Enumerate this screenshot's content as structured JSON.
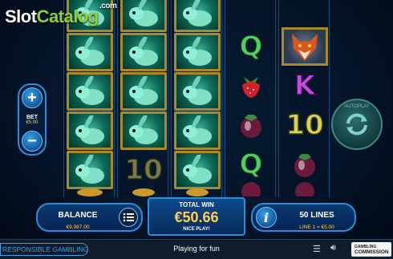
{
  "watermark": {
    "text_a": "Slot",
    "text_b": "Catalog",
    "suffix": ".com"
  },
  "colors": {
    "accent": "#2a8fd8",
    "gold": "#ffd24a",
    "panel": "#0b3b73",
    "link": "#3aa0e8"
  },
  "reels": [
    {
      "symbols": [
        "rabbit",
        "rabbit",
        "rabbit",
        "rabbit",
        "gold-coins"
      ]
    },
    {
      "symbols": [
        "rabbit",
        "rabbit",
        "rabbit",
        "ten",
        "gold-coins"
      ]
    },
    {
      "symbols": [
        "rabbit",
        "rabbit",
        "rabbit",
        "rabbit",
        "gold-coins"
      ]
    },
    {
      "symbols": [
        "letter-q",
        "strawberry",
        "mangosteen",
        "letter-q",
        "mangosteen"
      ]
    },
    {
      "symbols": [
        "fox",
        "letter-k",
        "ten",
        "mangosteen",
        "mangosteen"
      ]
    }
  ],
  "symbol_text": {
    "q": "Q",
    "k": "K",
    "ten": "10"
  },
  "bet": {
    "label": "BET",
    "value": "€5.00",
    "increase": "+",
    "decrease": "−"
  },
  "autoplay": {
    "label": "AUTOPLAY"
  },
  "balance": {
    "label": "BALANCE",
    "value": "€9,987.00"
  },
  "total_win": {
    "label": "TOTAL WIN",
    "amount": "€50.66",
    "message": "NICE PLAY!"
  },
  "lines": {
    "label": "50 LINES",
    "detail": "LINE 1 = €5.00",
    "info": "i"
  },
  "footer": {
    "responsible": "RESPONSIBLE GAMBLING",
    "mode": "Playing for fun",
    "gc_line1": "GAMBLING",
    "gc_line2": "COMMISSION"
  }
}
